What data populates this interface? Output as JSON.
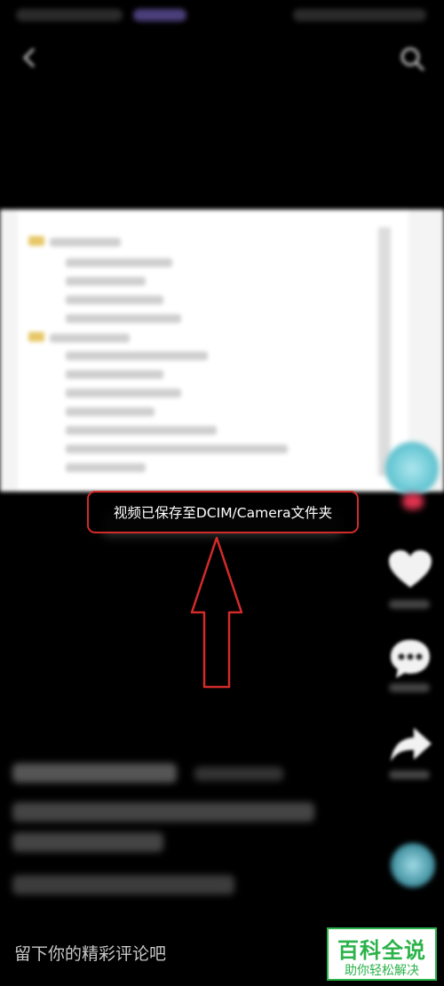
{
  "toast": {
    "message": "视频已保存至DCIM/Camera文件夹"
  },
  "comment": {
    "placeholder": "留下你的精彩评论吧"
  },
  "watermark": {
    "title": "百科全说",
    "subtitle": "助你轻松解决"
  },
  "colors": {
    "toast_border": "#d32a2a",
    "arrow": "#d32a2a",
    "watermark_green": "#2bb34a"
  },
  "icons": {
    "back": "back-arrow-icon",
    "search": "search-icon",
    "like": "heart-icon",
    "comment": "comment-bubble-icon",
    "share": "share-arrow-icon",
    "music": "music-disc-icon"
  }
}
